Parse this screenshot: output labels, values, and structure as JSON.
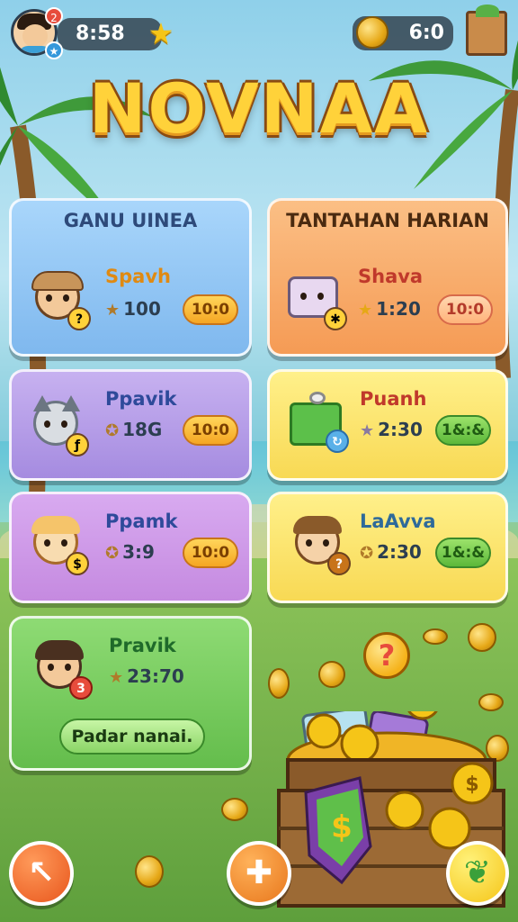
{
  "header": {
    "score": "8:58",
    "coins": "6:0",
    "notification_badge": "2",
    "level_badge": "★"
  },
  "title": "NOVNAA",
  "cards": {
    "left_header": "GANU UINEA",
    "right_header": "TANTAHAN HARIAN",
    "items": [
      {
        "name": "Spavh",
        "stat": "100",
        "time": "10:0"
      },
      {
        "name": "Shava",
        "stat": "1:20",
        "time": "10:0"
      },
      {
        "name": "Ppavik",
        "stat": "18G",
        "time": "10:0"
      },
      {
        "name": "Puanh",
        "stat": "2:30",
        "time": "1&:&"
      },
      {
        "name": "Ppamk",
        "stat": "3:9",
        "time": "10:0"
      },
      {
        "name": "LaAvva",
        "stat": "2:30",
        "time": "1&:&"
      },
      {
        "name": "Pravik",
        "stat": "23:70",
        "time": ""
      }
    ],
    "wide_button": "Padar nanai."
  },
  "bottom": {
    "left_icon": "back-arrow-icon",
    "center_icon": "puzzle-icon",
    "right_icon": "leaf-icon",
    "chest_icon": "treasure-chest-icon",
    "question_icon": "?"
  },
  "colors": {
    "title": "#ffd23a",
    "blue_card": "#8ec5f0",
    "orange_card": "#f6a765",
    "purple_card": "#b49be6",
    "yellow_card": "#fbe27a",
    "green_card": "#7ccf63"
  }
}
